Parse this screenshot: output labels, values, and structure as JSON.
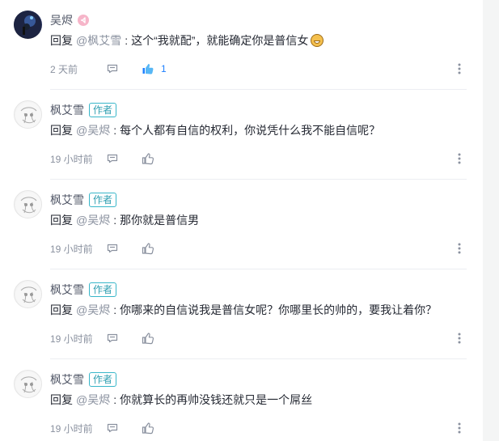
{
  "comments": [
    {
      "name": "吴烬",
      "author_badge": "",
      "reply_word": "回复",
      "mention": "@枫艾雪",
      "colon": ":",
      "text": "这个“我就配”，就能确定你是普信女",
      "time": "2 天前",
      "like_count": "1",
      "liked": true,
      "avatar_style": "dark",
      "has_vip": true,
      "has_emoji": true
    },
    {
      "name": "枫艾雪",
      "author_badge": "作者",
      "reply_word": "回复",
      "mention": "@吴烬",
      "colon": ":",
      "text": "每个人都有自信的权利，你说凭什么我不能自信呢？",
      "time": "19 小时前",
      "like_count": "",
      "liked": false,
      "avatar_style": "sketch",
      "has_vip": false,
      "has_emoji": false
    },
    {
      "name": "枫艾雪",
      "author_badge": "作者",
      "reply_word": "回复",
      "mention": "@吴烬",
      "colon": ":",
      "text": "那你就是普信男",
      "time": "19 小时前",
      "like_count": "",
      "liked": false,
      "avatar_style": "sketch",
      "has_vip": false,
      "has_emoji": false
    },
    {
      "name": "枫艾雪",
      "author_badge": "作者",
      "reply_word": "回复",
      "mention": "@吴烬",
      "colon": ":",
      "text": "你哪来的自信说我是普信女呢？你哪里长的帅的，要我让着你？",
      "time": "19 小时前",
      "like_count": "",
      "liked": false,
      "avatar_style": "sketch",
      "has_vip": false,
      "has_emoji": false
    },
    {
      "name": "枫艾雪",
      "author_badge": "作者",
      "reply_word": "回复",
      "mention": "@吴烬",
      "colon": ":",
      "text": "你就算长的再帅没钱还就只是一个屌丝",
      "time": "19 小时前",
      "like_count": "",
      "liked": false,
      "avatar_style": "sketch",
      "has_vip": false,
      "has_emoji": false
    }
  ],
  "icons": {
    "vip": "vip-badge-icon",
    "emoji": "grinning-emoji-icon",
    "comment": "comment-icon",
    "like": "thumbs-up-icon",
    "more": "more-vertical-icon"
  },
  "colors": {
    "author_badge": "#38b6c9",
    "mention": "#8a919f",
    "like_active": "#1e80ff",
    "text": "#252933",
    "meta": "#8a919f",
    "background_strip": "#f4f5f5"
  }
}
